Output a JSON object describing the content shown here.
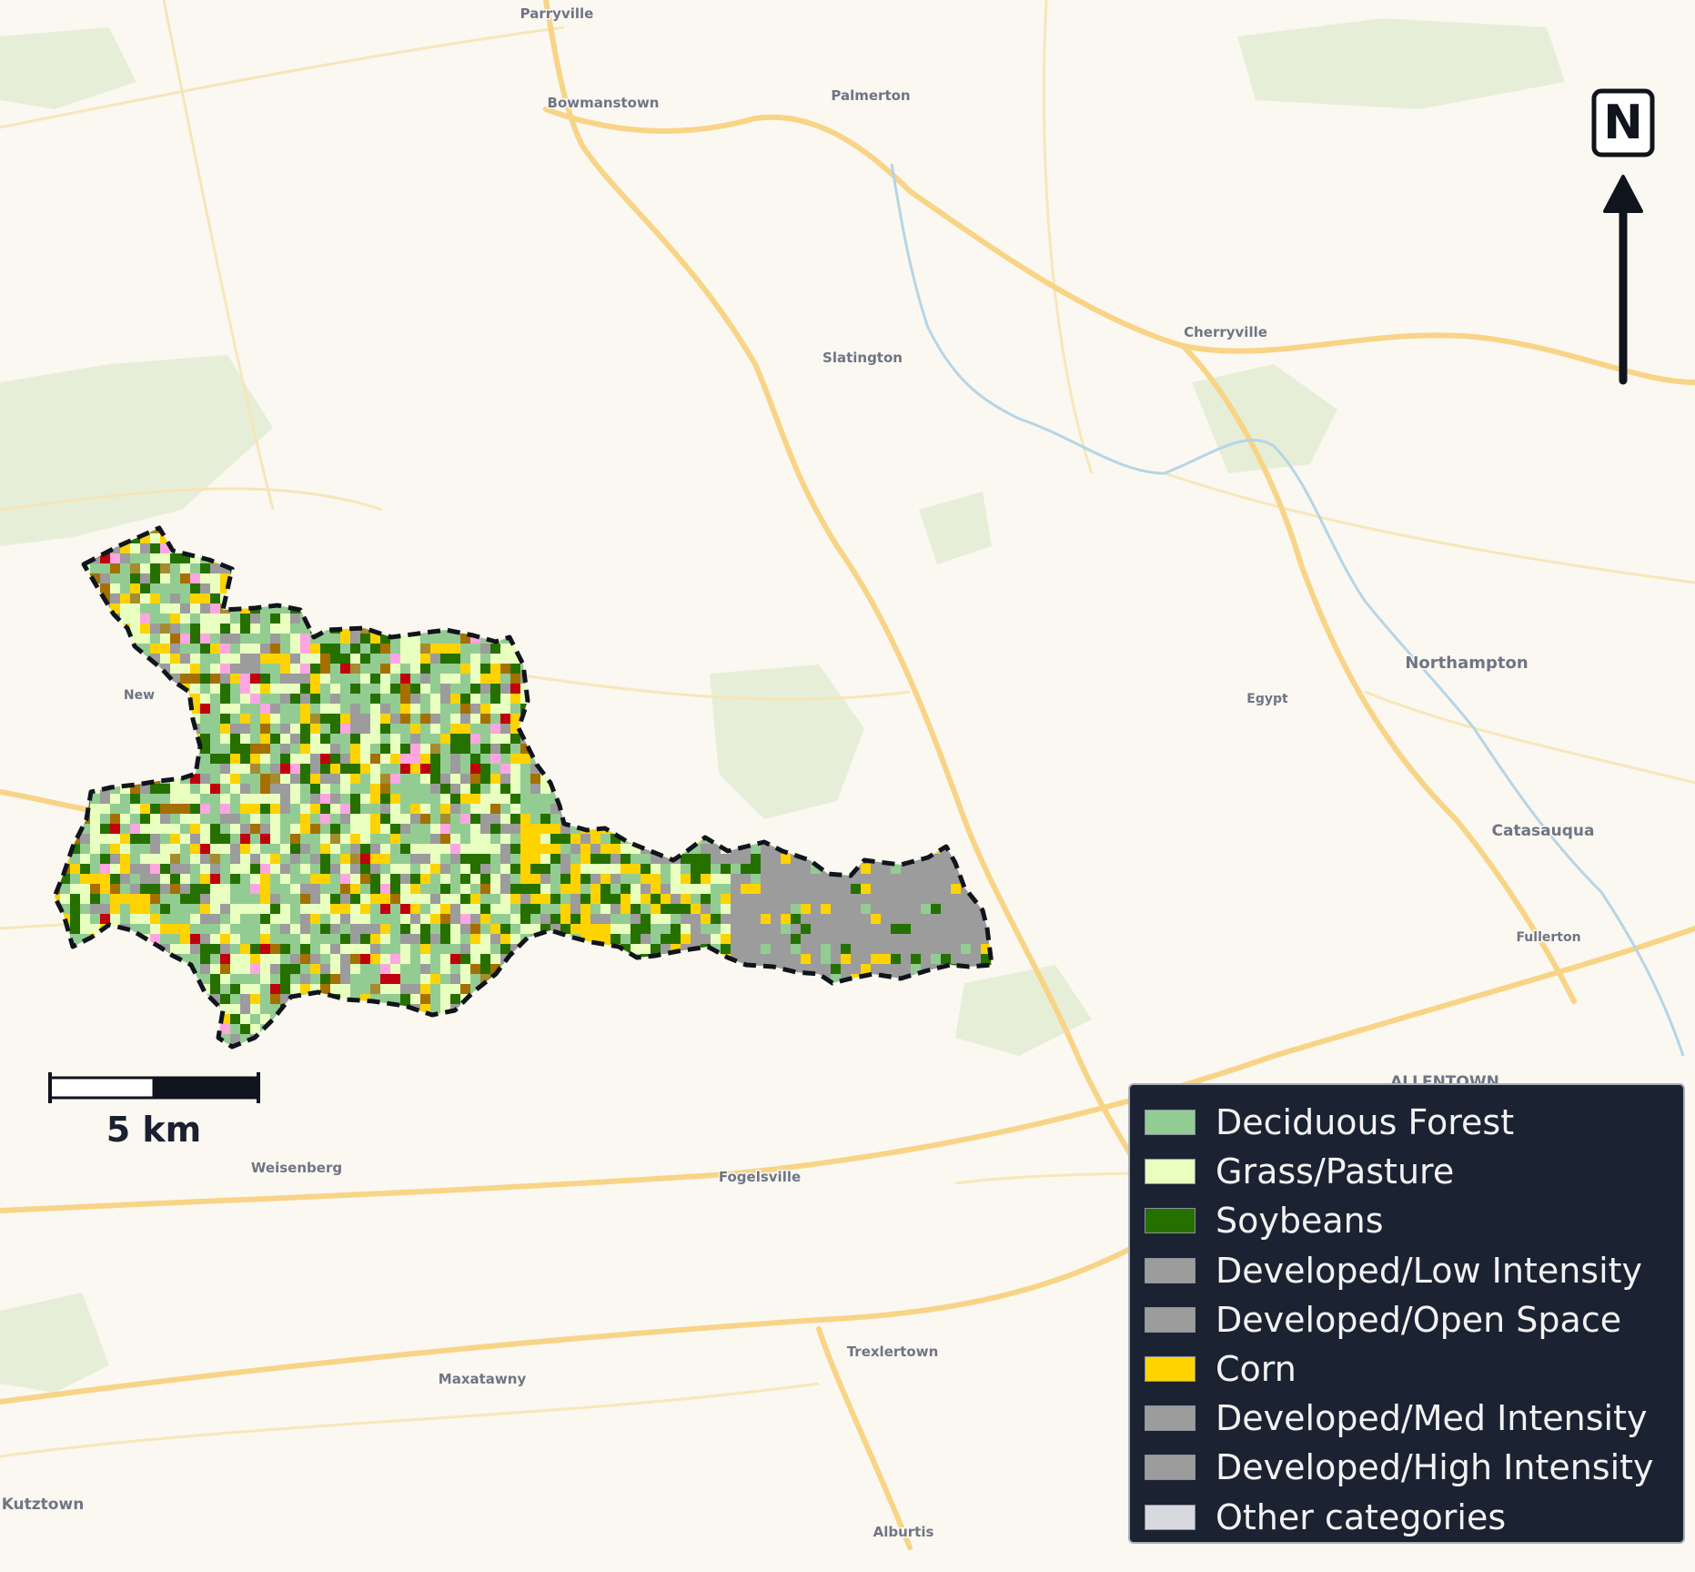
{
  "basemap": {
    "places": [
      {
        "name": "Parryville"
      },
      {
        "name": "Bowmanstown"
      },
      {
        "name": "Palmerton"
      },
      {
        "name": "Slatington"
      },
      {
        "name": "Cherryville"
      },
      {
        "name": "Northampton"
      },
      {
        "name": "Egypt"
      },
      {
        "name": "Catasauqua"
      },
      {
        "name": "Fullerton"
      },
      {
        "name": "New"
      },
      {
        "name": "Weisenberg"
      },
      {
        "name": "Fogelsville"
      },
      {
        "name": "Trexlertown"
      },
      {
        "name": "Maxatawny"
      },
      {
        "name": "Kutztown"
      },
      {
        "name": "Alburtis"
      },
      {
        "name": "ALLENTOWN"
      }
    ]
  },
  "scale_bar": {
    "label": "5 km"
  },
  "north_arrow": {
    "letter": "N"
  },
  "landcover": {
    "colors": {
      "deciduous_forest": "#93cc93",
      "grass_pasture": "#e8ffbf",
      "soybeans": "#267000",
      "developed": "#9c9c9c",
      "corn": "#ffd300",
      "alfalfa": "#ffa5e2",
      "other_hay": "#a58c30",
      "other_red": "#c0000c",
      "winter_wheat": "#a57000"
    }
  },
  "legend": {
    "items": [
      {
        "label": "Deciduous Forest",
        "color": "#93cc93"
      },
      {
        "label": "Grass/Pasture",
        "color": "#e8ffbf"
      },
      {
        "label": "Soybeans",
        "color": "#267000"
      },
      {
        "label": "Developed/Low Intensity",
        "color": "#9c9c9c"
      },
      {
        "label": "Developed/Open Space",
        "color": "#9c9c9c"
      },
      {
        "label": "Corn",
        "color": "#ffd300"
      },
      {
        "label": "Developed/Med Intensity",
        "color": "#9c9c9c"
      },
      {
        "label": "Developed/High Intensity",
        "color": "#9c9c9c"
      },
      {
        "label": "Other categories",
        "color": "#d7d9de"
      }
    ]
  }
}
